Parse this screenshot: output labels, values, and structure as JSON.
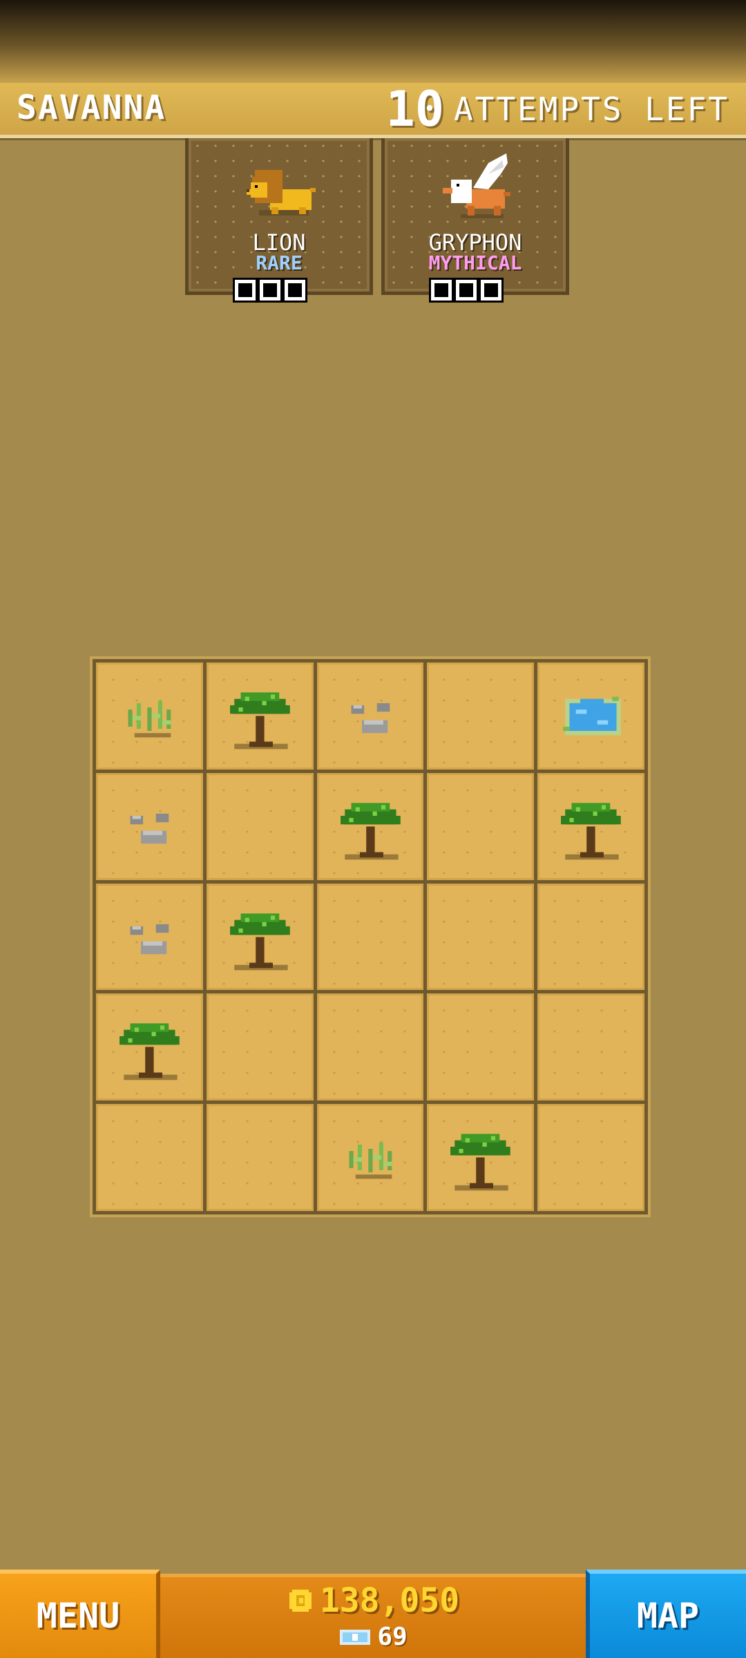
{
  "header": {
    "biome_name": "SAVANNA",
    "attempts_count": "10",
    "attempts_label": "ATTEMPTS LEFT"
  },
  "animals": [
    {
      "name": "LION",
      "rarity": "RARE",
      "rarity_color": "#9fd0ff",
      "icon": "lion-icon",
      "slots": 3
    },
    {
      "name": "GRYPHON",
      "rarity": "MYTHICAL",
      "rarity_color": "#ff9cf0",
      "icon": "gryphon-icon",
      "slots": 3
    }
  ],
  "board": {
    "rows": 5,
    "cols": 5,
    "tiles": [
      [
        "bush",
        "tree",
        "rocks",
        "empty",
        "water"
      ],
      [
        "rocks",
        "empty",
        "tree",
        "empty",
        "tree"
      ],
      [
        "rocks",
        "tree",
        "empty",
        "empty",
        "empty"
      ],
      [
        "tree",
        "empty",
        "empty",
        "empty",
        "empty"
      ],
      [
        "empty",
        "empty",
        "bush",
        "tree",
        "empty"
      ]
    ]
  },
  "footer": {
    "menu_label": "MENU",
    "coins": "138,050",
    "gems": "69",
    "map_label": "MAP"
  },
  "colors": {
    "background": "#a58a4d",
    "header": "#dcb454",
    "menu_button": "#f39a18",
    "map_button": "#1aa0ec",
    "coin_text": "#ffd632"
  }
}
